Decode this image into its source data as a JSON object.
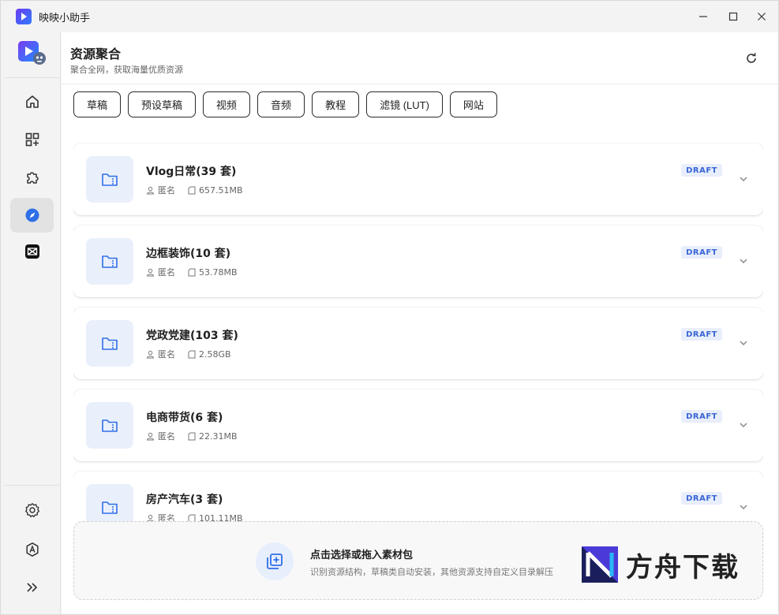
{
  "window": {
    "title": "映映小助手"
  },
  "header": {
    "title": "资源聚合",
    "subtitle": "聚合全网，获取海量优质资源"
  },
  "tabs": [
    {
      "label": "草稿"
    },
    {
      "label": "预设草稿"
    },
    {
      "label": "视频"
    },
    {
      "label": "音频"
    },
    {
      "label": "教程"
    },
    {
      "label": "滤镜 (LUT)"
    },
    {
      "label": "网站"
    }
  ],
  "resources": [
    {
      "name": "Vlog日常(39 套)",
      "author": "匿名",
      "size": "657.51MB",
      "badge": "DRAFT"
    },
    {
      "name": "边框装饰(10 套)",
      "author": "匿名",
      "size": "53.78MB",
      "badge": "DRAFT"
    },
    {
      "name": "党政党建(103 套)",
      "author": "匿名",
      "size": "2.58GB",
      "badge": "DRAFT"
    },
    {
      "name": "电商带货(6 套)",
      "author": "匿名",
      "size": "22.31MB",
      "badge": "DRAFT"
    },
    {
      "name": "房产汽车(3 套)",
      "author": "匿名",
      "size": "101.11MB",
      "badge": "DRAFT"
    }
  ],
  "dropzone": {
    "title": "点击选择或拖入素材包",
    "hint": "识别资源结构，草稿类自动安装，其他资源支持自定义目录解压"
  },
  "watermark": {
    "text": "方舟下载"
  },
  "colors": {
    "accent": "#3a66d6",
    "badge_bg": "#e8eefb",
    "thumb_bg": "#eaf0fb"
  }
}
